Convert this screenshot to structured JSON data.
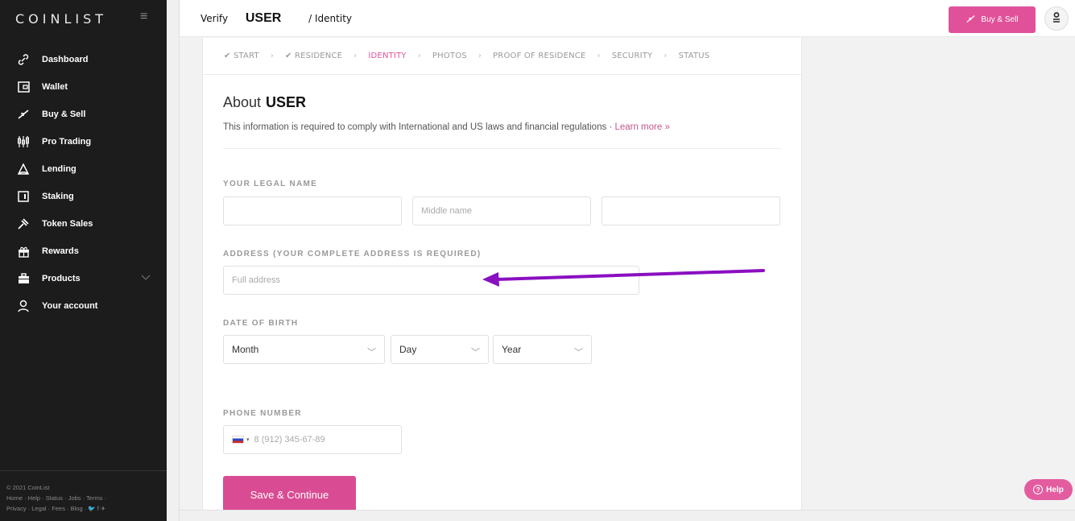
{
  "brand": {
    "logo": "COINLIST"
  },
  "sidebar": {
    "items": [
      {
        "label": "Dashboard",
        "icon": "link-icon"
      },
      {
        "label": "Wallet",
        "icon": "wallet-icon"
      },
      {
        "label": "Buy & Sell",
        "icon": "exchange-icon"
      },
      {
        "label": "Pro Trading",
        "icon": "candles-icon"
      },
      {
        "label": "Lending",
        "icon": "lending-icon"
      },
      {
        "label": "Staking",
        "icon": "staking-icon"
      },
      {
        "label": "Token Sales",
        "icon": "hammer-icon"
      },
      {
        "label": "Rewards",
        "icon": "gift-icon"
      },
      {
        "label": "Products",
        "icon": "briefcase-icon"
      },
      {
        "label": "Your account",
        "icon": "user-icon"
      }
    ],
    "footer_copyright": "© 2021 CoinList",
    "footer_links_1": "Home · Help · Status · Jobs · Terms ·",
    "footer_links_2": "Privacy · Legal · Fees · Blog · ",
    "footer_social": "🐦 f ✈"
  },
  "header": {
    "verify": "Verify",
    "user": "USER",
    "section": "/ Identity",
    "buy_sell": "Buy & Sell"
  },
  "steps": {
    "start": "START",
    "residence": "RESIDENCE",
    "identity": "IDENTITY",
    "photos": "PHOTOS",
    "proof": "PROOF OF RESIDENCE",
    "security": "SECURITY",
    "status": "STATUS"
  },
  "form": {
    "about": "About",
    "user": "USER",
    "info": "This information is required to comply with International and US laws and financial regulations · ",
    "learn_more": "Learn more »",
    "legal_name_label": "YOUR LEGAL NAME",
    "middle_placeholder": "Middle name",
    "address_label": "ADDRESS (YOUR COMPLETE ADDRESS IS REQUIRED)",
    "address_placeholder": "Full address",
    "dob_label": "DATE OF BIRTH",
    "month": "Month",
    "day": "Day",
    "year": "Year",
    "phone_label": "PHONE NUMBER",
    "phone_placeholder": "8 (912) 345-67-89",
    "save": "Save & Continue"
  },
  "help": "Help",
  "colors": {
    "accent": "#e0519a",
    "sidebar": "#1c1c1c",
    "arrow": "#8a0fc0"
  }
}
